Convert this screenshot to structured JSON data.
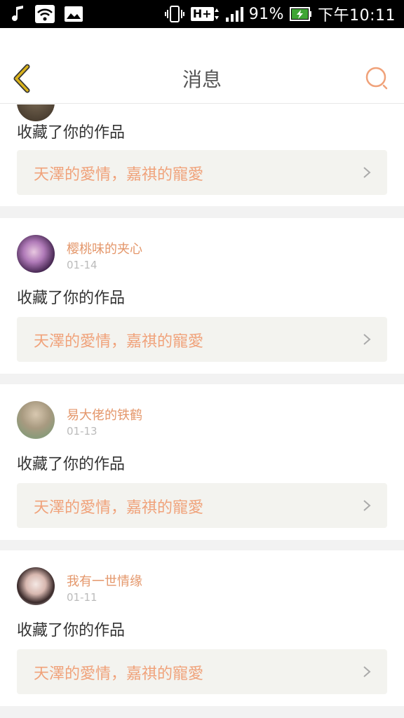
{
  "status_bar": {
    "network": "H+",
    "battery": "91%",
    "time": "下午10:11",
    "icons": [
      "music-note-icon",
      "wifi-icon",
      "image-icon",
      "vibrate-icon",
      "signal-icon",
      "battery-charging-icon"
    ]
  },
  "header": {
    "title": "消息",
    "back_icon": "chevron-left-icon",
    "search_icon": "search-icon"
  },
  "colors": {
    "accent": "#e4976b",
    "link_text": "#f0a27a",
    "back_arrow": "#c9a21a"
  },
  "notifications": [
    {
      "action": "收藏了你的作品",
      "work_title": "天澤的愛情，嘉祺的寵愛"
    },
    {
      "user": "樱桃味的夹心",
      "date": "01-14",
      "action": "收藏了你的作品",
      "work_title": "天澤的愛情，嘉祺的寵愛"
    },
    {
      "user": "易大佬的铁鹤",
      "date": "01-13",
      "action": "收藏了你的作品",
      "work_title": "天澤的愛情，嘉祺的寵愛"
    },
    {
      "user": "我有一世情缘",
      "date": "01-11",
      "action": "收藏了你的作品",
      "work_title": "天澤的愛情，嘉祺的寵愛"
    }
  ]
}
